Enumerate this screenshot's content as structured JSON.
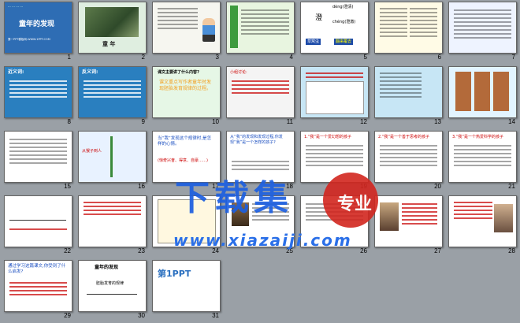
{
  "slides": [
    {
      "n": "1",
      "title": "童年的发现",
      "sub": "第一PPT模板网-WWW.1PPT.COM",
      "bg": "#2e6db4"
    },
    {
      "n": "2",
      "title": "童 年",
      "bg": "#dfeee0"
    },
    {
      "n": "3",
      "bg": "#f6f6f0"
    },
    {
      "n": "4",
      "bg": "#e8f5e0"
    },
    {
      "n": "5",
      "title": "澄",
      "line1": "dèng(澄清)",
      "line2": "chéng(澄澈)",
      "btn1": "草窝虫",
      "btn2": "翻来覆去",
      "bg": "#fff"
    },
    {
      "n": "6",
      "bg": "#fffbe6"
    },
    {
      "n": "7",
      "bg": "#eef3ff"
    },
    {
      "n": "8",
      "head": "近义词:",
      "body": "疑问(疑惑)  限制(约束)  惧怕(害怕)",
      "bg": "#2a7fbf"
    },
    {
      "n": "9",
      "head": "反义词:",
      "body": "一本正经(嘻嘻哈哈)  随心所欲(左右为难)",
      "bg": "#2a7fbf"
    },
    {
      "n": "10",
      "title": "课文主要讲了什么内容?",
      "body": "课文重点写作者童年时发现胚胎发育规律的过程。",
      "bg": "#e6f7e6"
    },
    {
      "n": "11",
      "title": "小组讨论:",
      "bg": "#f4f4f4"
    },
    {
      "n": "12",
      "bg": "#c7e6f5"
    },
    {
      "n": "13",
      "bg": "#c7e6f5"
    },
    {
      "n": "14",
      "bg": "#e2f4ff"
    },
    {
      "n": "15",
      "bg": "#ffffff"
    },
    {
      "n": "16",
      "label": "从猴子到人",
      "bg": "#e8f2ff"
    },
    {
      "n": "17",
      "title": "当“我”发现这个规律时,是怎样的心情。",
      "body": "(惊奇兴奋、得意、自豪……)",
      "bg": "#ffffff"
    },
    {
      "n": "18",
      "title": "从“我”的发现和发现过程,你发现“我”是一个怎样的孩子?",
      "bg": "#ffffff"
    },
    {
      "n": "19",
      "title": "1.“我”是一个爱幻想的孩子",
      "bg": "#ffffff"
    },
    {
      "n": "20",
      "title": "2.“我”是一个善于思考的孩子",
      "bg": "#ffffff"
    },
    {
      "n": "21",
      "title": "3.“我”是一个热爱科学的孩子",
      "bg": "#ffffff"
    },
    {
      "n": "22",
      "bg": "#ffffff"
    },
    {
      "n": "23",
      "bg": "#ffffff"
    },
    {
      "n": "24",
      "bg": "#ffffff"
    },
    {
      "n": "25",
      "bg": "#ffffff"
    },
    {
      "n": "26",
      "bg": "#ffffff"
    },
    {
      "n": "27",
      "bg": "#ffffff"
    },
    {
      "n": "28",
      "bg": "#ffffff"
    },
    {
      "n": "29",
      "title": "通过学习这篇课文,你受到了什么启发?",
      "bg": "#ffffff"
    },
    {
      "n": "30",
      "title": "童年的发现",
      "sub": "胚胎发育的规律",
      "bg": "#ffffff"
    },
    {
      "n": "31",
      "title": "第1PPT",
      "bg": "#ffffff"
    }
  ],
  "watermark": {
    "text": "下载集",
    "badge": "专业",
    "url": "www.xiazaiji.com"
  }
}
